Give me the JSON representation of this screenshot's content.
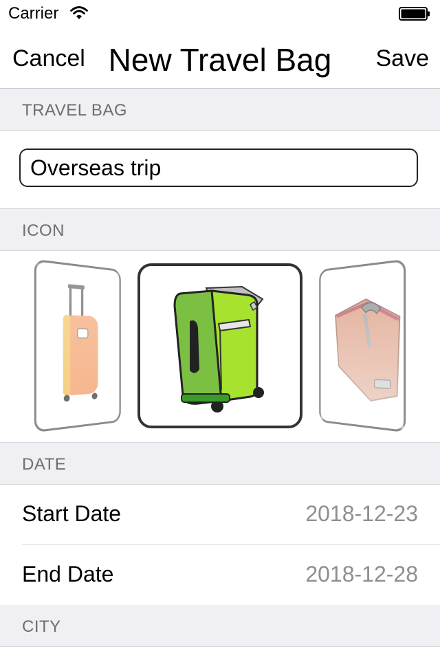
{
  "status_bar": {
    "carrier": "Carrier",
    "icons": [
      "wifi-icon",
      "battery-icon"
    ]
  },
  "nav": {
    "cancel_label": "Cancel",
    "title": "New Travel Bag",
    "save_label": "Save"
  },
  "sections": {
    "travel_bag": "TRAVEL BAG",
    "icon": "ICON",
    "date": "DATE",
    "city": "CITY"
  },
  "travel_bag": {
    "name_value": "Overseas trip"
  },
  "icon_picker": {
    "items": [
      "orange-suitcase-icon",
      "green-suitcase-icon",
      "brown-bag-icon"
    ],
    "selected": "green-suitcase-icon"
  },
  "dates": {
    "start_label": "Start Date",
    "start_value": "2018-12-23",
    "end_label": "End Date",
    "end_value": "2018-12-28"
  },
  "colors": {
    "section_bg": "#efeff4",
    "section_text": "#6d6d72",
    "value_text": "#8e8e93",
    "selected_border": "#333333"
  }
}
